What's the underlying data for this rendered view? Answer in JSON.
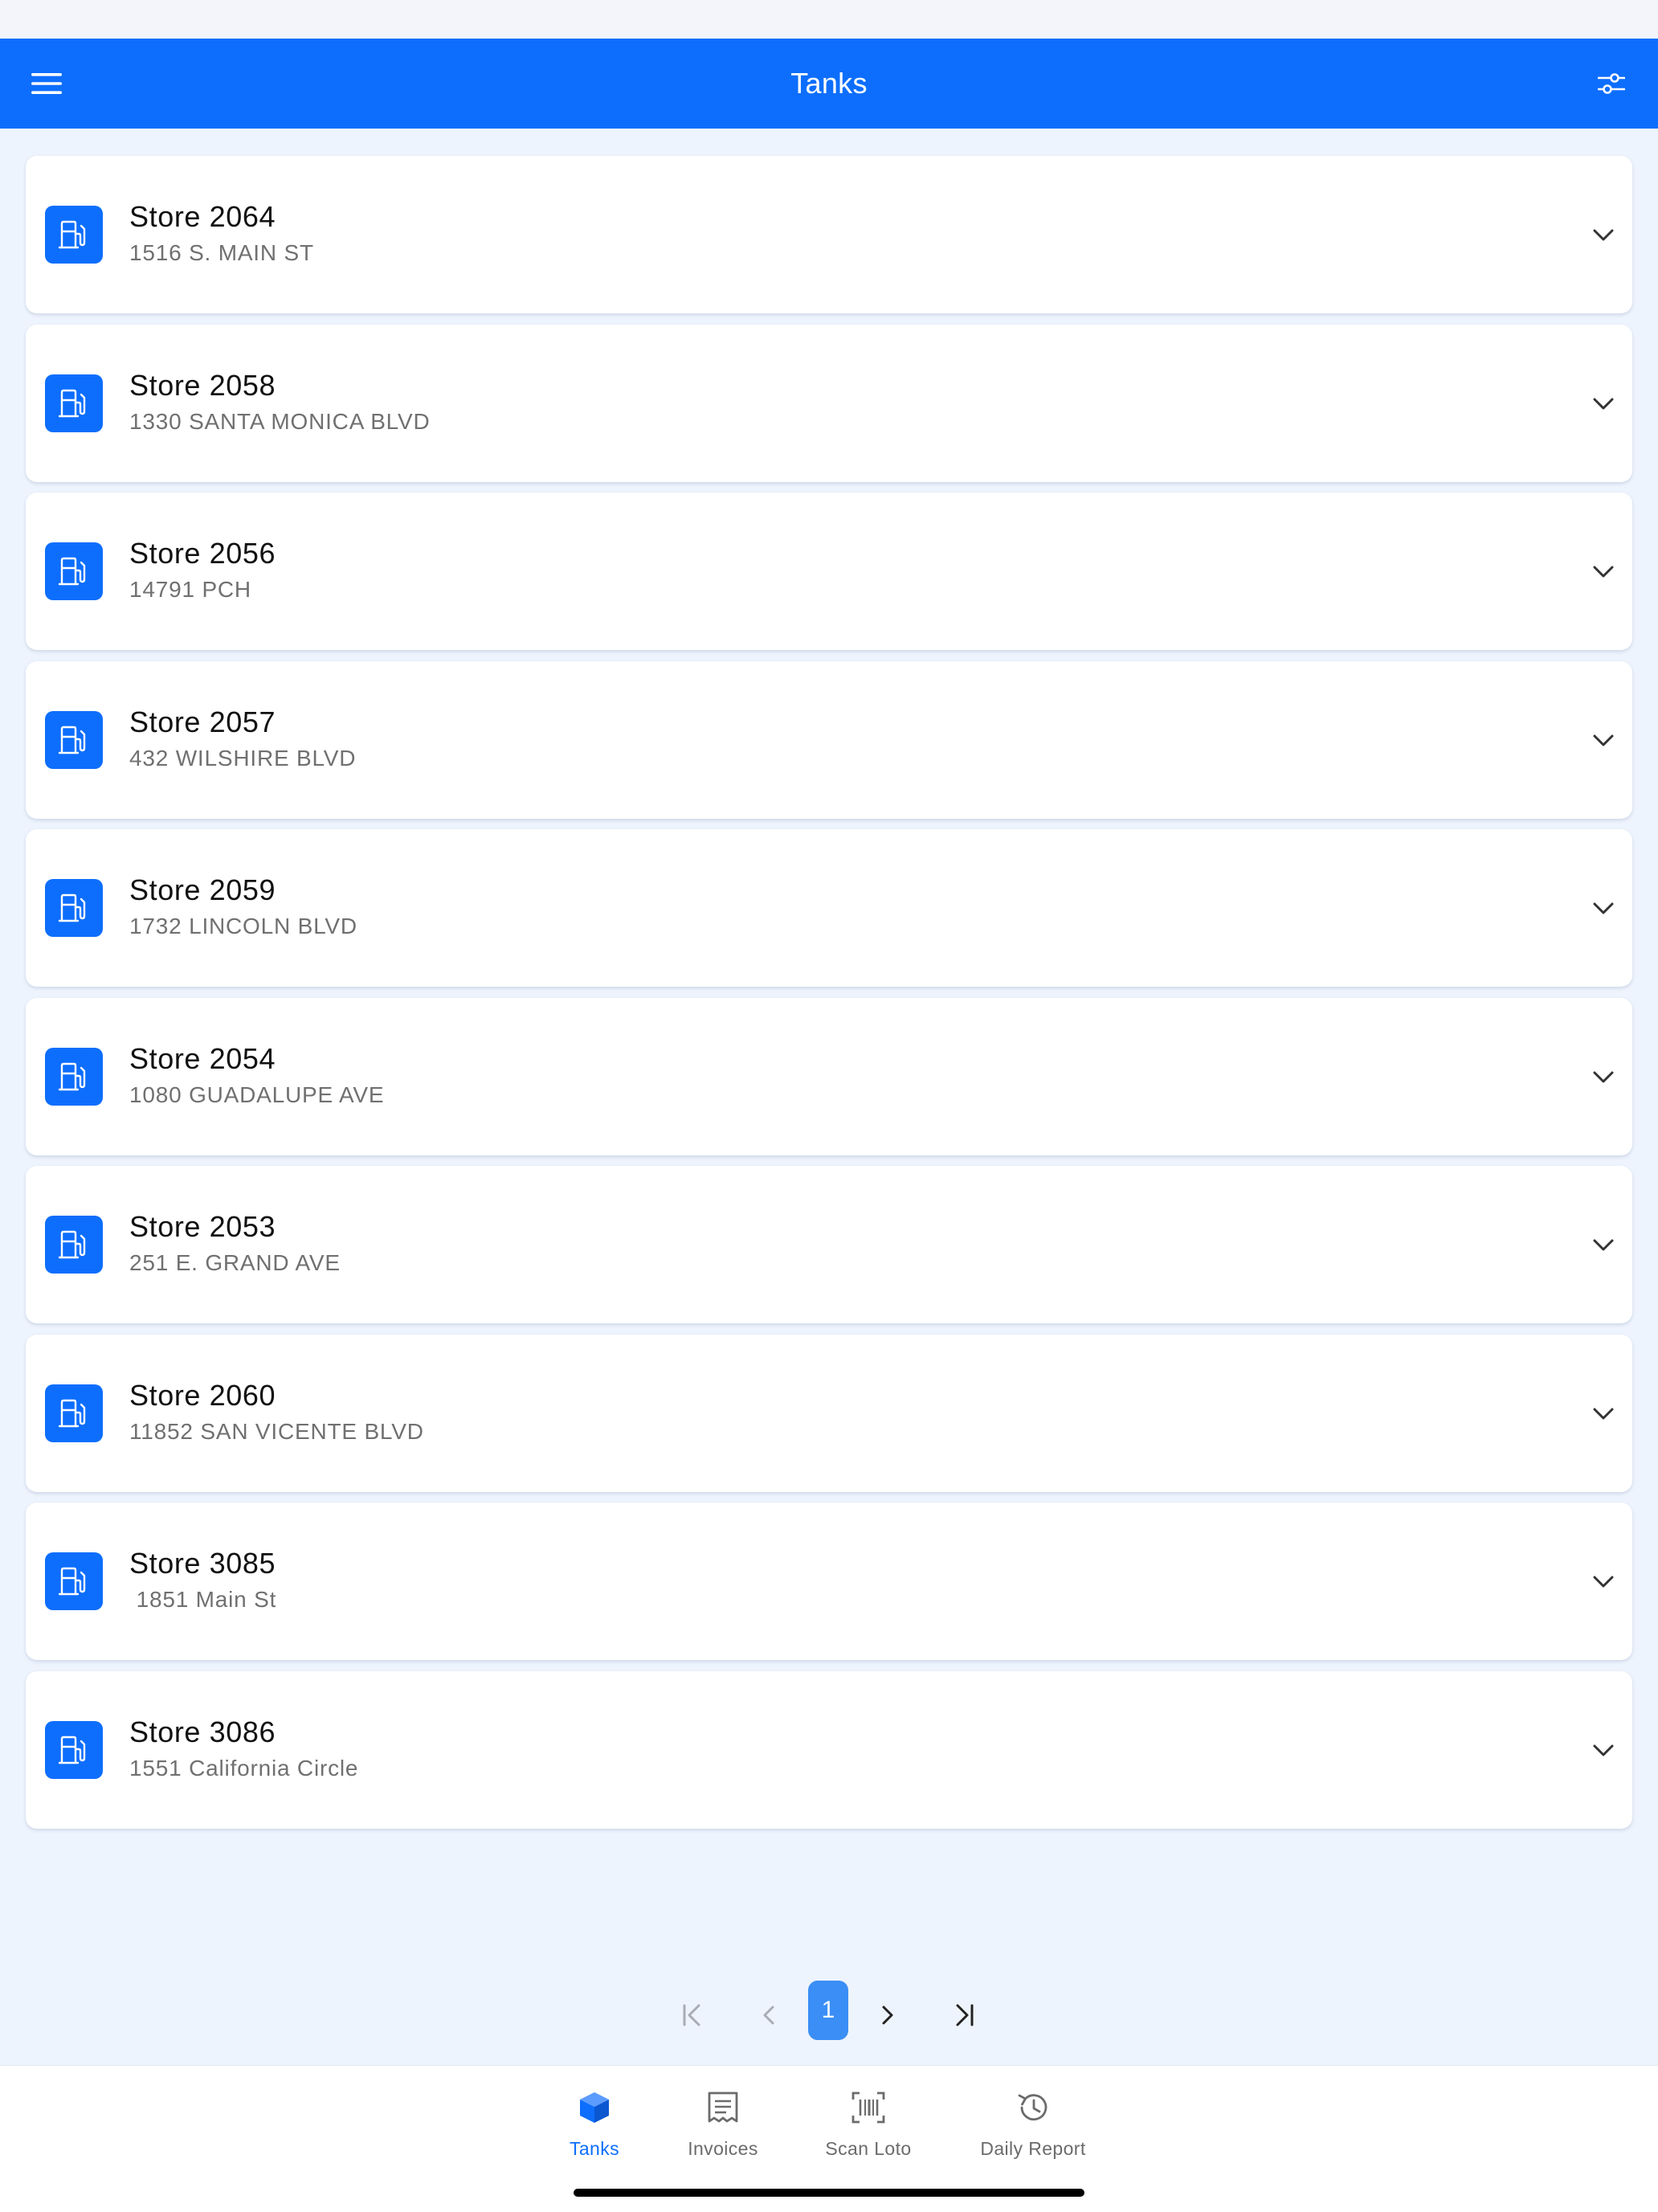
{
  "header": {
    "title": "Tanks",
    "menu_icon": "hamburger-menu-icon",
    "filter_icon": "sliders-icon"
  },
  "colors": {
    "primary": "#0d6efd",
    "background": "#eef4fd",
    "page_active": "#3b8ef5"
  },
  "stores": [
    {
      "name": "Store 2064",
      "address": "1516 S. MAIN ST"
    },
    {
      "name": "Store 2058",
      "address": "1330 SANTA MONICA BLVD"
    },
    {
      "name": "Store 2056",
      "address": "14791 PCH"
    },
    {
      "name": "Store 2057",
      "address": "432 WILSHIRE BLVD"
    },
    {
      "name": "Store 2059",
      "address": "1732 LINCOLN BLVD"
    },
    {
      "name": "Store 2054",
      "address": "1080 GUADALUPE AVE"
    },
    {
      "name": "Store 2053",
      "address": "251 E. GRAND AVE"
    },
    {
      "name": "Store 2060",
      "address": "11852 SAN VICENTE BLVD"
    },
    {
      "name": "Store 3085",
      "address": " 1851 Main St"
    },
    {
      "name": "Store 3086",
      "address": "1551 California Circle"
    }
  ],
  "pagination": {
    "current_page": "1"
  },
  "bottom_nav": {
    "items": [
      {
        "label": "Tanks",
        "icon": "cube-icon",
        "active": true
      },
      {
        "label": "Invoices",
        "icon": "receipt-icon",
        "active": false
      },
      {
        "label": "Scan Loto",
        "icon": "barcode-scan-icon",
        "active": false
      },
      {
        "label": "Daily Report",
        "icon": "history-icon",
        "active": false
      }
    ]
  }
}
